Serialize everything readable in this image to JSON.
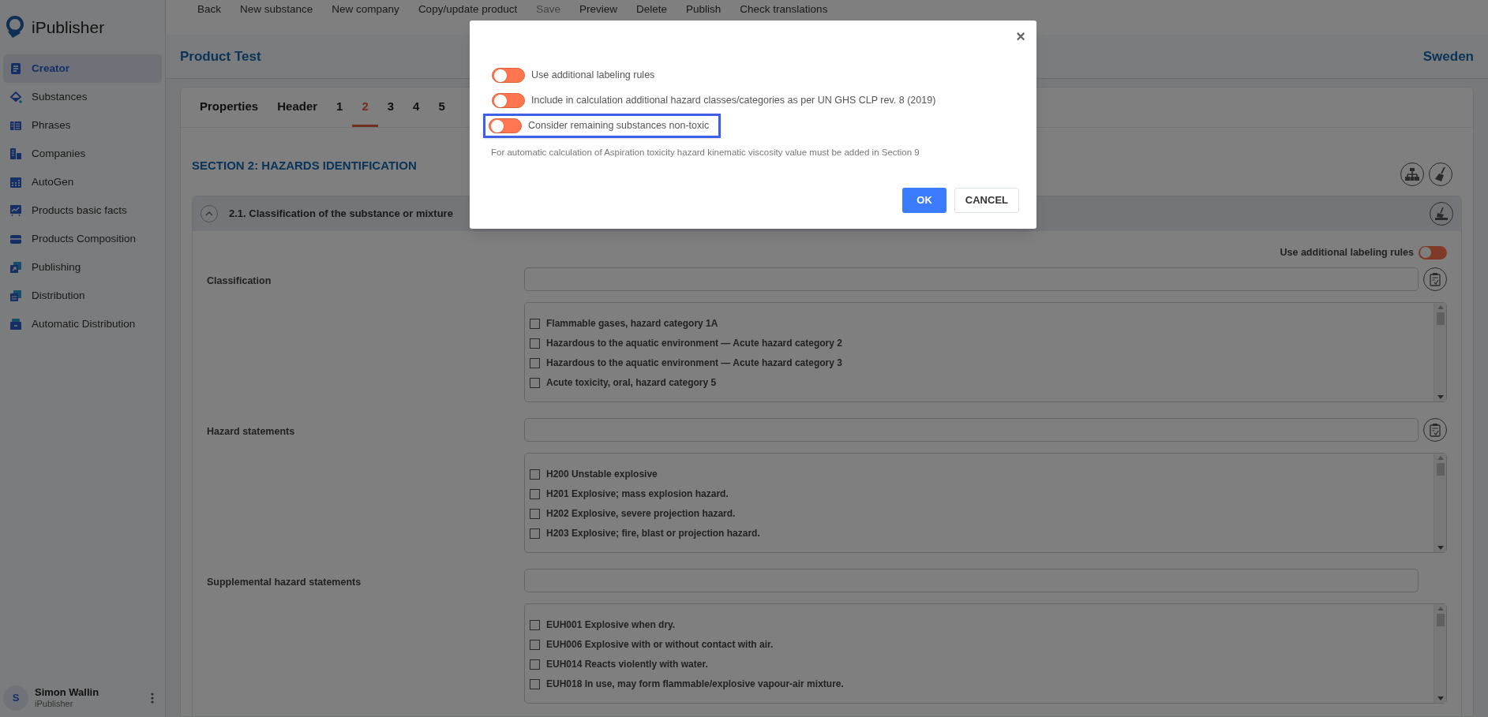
{
  "app": {
    "logo_text": "iPublisher"
  },
  "sidebar": {
    "items": [
      {
        "label": "Creator",
        "selected": true
      },
      {
        "label": "Substances",
        "selected": false
      },
      {
        "label": "Phrases",
        "selected": false
      },
      {
        "label": "Companies",
        "selected": false
      },
      {
        "label": "AutoGen",
        "selected": false
      },
      {
        "label": "Products basic facts",
        "selected": false
      },
      {
        "label": "Products Composition",
        "selected": false
      },
      {
        "label": "Publishing",
        "selected": false
      },
      {
        "label": "Distribution",
        "selected": false
      },
      {
        "label": "Automatic Distribution",
        "selected": false
      }
    ],
    "user": {
      "initial": "S",
      "name": "Simon Wallin",
      "subtitle": "iPublisher"
    }
  },
  "toolbar": {
    "items": [
      {
        "label": "Back",
        "disabled": false
      },
      {
        "label": "New substance",
        "disabled": false
      },
      {
        "label": "New company",
        "disabled": false
      },
      {
        "label": "Copy/update product",
        "disabled": false
      },
      {
        "label": "Save",
        "disabled": true
      },
      {
        "label": "Preview",
        "disabled": false
      },
      {
        "label": "Delete",
        "disabled": false
      },
      {
        "label": "Publish",
        "disabled": false
      },
      {
        "label": "Check translations",
        "disabled": false
      }
    ]
  },
  "header": {
    "title": "Product Test",
    "country": "Sweden"
  },
  "tabs": [
    {
      "label": "Properties",
      "selected": false
    },
    {
      "label": "Header",
      "selected": false
    },
    {
      "label": "1",
      "selected": false
    },
    {
      "label": "2",
      "selected": true
    },
    {
      "label": "3",
      "selected": false
    },
    {
      "label": "4",
      "selected": false
    },
    {
      "label": "5",
      "selected": false
    }
  ],
  "section": {
    "title": "SECTION 2: HAZARDS IDENTIFICATION",
    "subsection": {
      "title": "2.1. Classification of the substance or mixture",
      "expanded": true,
      "labeling_toggle": {
        "label": "Use additional labeling rules",
        "on": false
      },
      "fields": [
        {
          "label": "Classification",
          "options": [
            {
              "label": "Flammable gases, hazard category 1A",
              "checked": false
            },
            {
              "label": "Hazardous to the aquatic environment — Acute hazard category 2",
              "checked": false
            },
            {
              "label": "Hazardous to the aquatic environment — Acute hazard category 3",
              "checked": false
            },
            {
              "label": "Acute toxicity, oral, hazard category 5",
              "checked": false
            }
          ]
        },
        {
          "label": "Hazard statements",
          "options": [
            {
              "label": "H200 Unstable explosive",
              "checked": false
            },
            {
              "label": "H201 Explosive; mass explosion hazard.",
              "checked": false
            },
            {
              "label": "H202 Explosive, severe projection hazard.",
              "checked": false
            },
            {
              "label": "H203 Explosive; fire, blast or projection hazard.",
              "checked": false
            }
          ]
        },
        {
          "label": "Supplemental hazard statements",
          "options": [
            {
              "label": "EUH001 Explosive when dry.",
              "checked": false
            },
            {
              "label": "EUH006 Explosive with or without contact with air.",
              "checked": false
            },
            {
              "label": "EUH014 Reacts violently with water.",
              "checked": false
            },
            {
              "label": "EUH018 In use, may form flammable/explosive vapour-air mixture.",
              "checked": false
            }
          ]
        }
      ]
    }
  },
  "dialog": {
    "close": "×",
    "toggles": [
      {
        "label": "Use additional labeling rules",
        "on": false,
        "highlighted": false
      },
      {
        "label": "Include in calculation additional hazard classes/categories as per UN GHS CLP rev. 8 (2019)",
        "on": false,
        "highlighted": false
      },
      {
        "label": "Consider remaining substances non-toxic",
        "on": false,
        "highlighted": true
      }
    ],
    "note": "For automatic calculation of Aspiration toxicity hazard kinematic viscosity value must be added in Section 9",
    "buttons": [
      {
        "label": "OK",
        "kind": "primary"
      },
      {
        "label": "CANCEL",
        "kind": "secondary"
      }
    ]
  }
}
